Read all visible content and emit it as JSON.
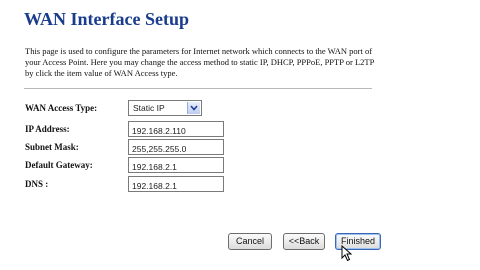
{
  "page": {
    "title": "WAN Interface Setup",
    "description": "This page is used to configure the parameters for Internet network which connects to the WAN port of your Access Point. Here you may change the access method to static IP, DHCP, PPPoE, PPTP or L2TP by click the item value of WAN Access type."
  },
  "form": {
    "access_type": {
      "label": "WAN Access Type:",
      "value": "Static IP"
    },
    "ip_address": {
      "label": "IP Address:",
      "value": "192.168.2.110"
    },
    "subnet_mask": {
      "label": "Subnet Mask:",
      "value": "255,255.255.0"
    },
    "default_gateway": {
      "label": "Default Gateway:",
      "value": "192.168.2.1"
    },
    "dns": {
      "label": "DNS :",
      "value": "192.168.2.1"
    }
  },
  "buttons": {
    "cancel": "Cancel",
    "back": "<<Back",
    "finished": "Finished"
  },
  "colors": {
    "title": "#1a3c8c",
    "divider": "#b8b8b8"
  },
  "icons": {
    "select_arrow": "chevron-down-icon",
    "cursor": "mouse-pointer-icon"
  }
}
